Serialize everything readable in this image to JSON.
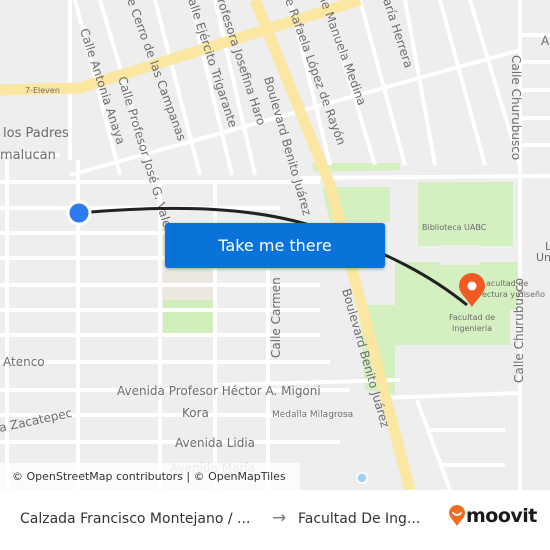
{
  "map": {
    "streets": {
      "calle_antonia_anaya": "Calle Antonia Anaya",
      "calle_cerro_campanas": "e Cerro de las Campanas",
      "calle_ejercito_trigarante": "alle Ejército Trigarante",
      "profesora_josefina_haro": "rofesora Josefina Haro",
      "calle_profesor_jose_valenzuela": "Calle Profesor José G. Valenzuela",
      "rafaela_lopez_rayon": "e Rafaela López de Rayón",
      "manuela_medina": "le Manuela Medina",
      "maria_herrera": "aría Herrera",
      "calle_churubusco_top": "Calle Churubusco",
      "calle_churubusco_bottom": "Calle Churubusco",
      "boulevard_benito_juarez_top": "Boulevard Benito Juárez",
      "boulevard_benito_juarez_bottom": "Boulevard Benito Juárez",
      "calle_carmen": "Calle Carmen",
      "los_padres": "los Padres",
      "amalucan": "malucan",
      "atenco": "Atenco",
      "avenida_hector_migoni": "Avenida Profesor Héctor A. Migoni",
      "zacatepec": "a Zacatepec",
      "kora": "Kora",
      "medalla_milagrosa": "Medalla Milagrosa",
      "avenida_lidia": "Avenida Lidia",
      "avenida_maria": "Avenida María",
      "edge_a": "A",
      "edge_l": "L",
      "edge_uni": "Uni"
    },
    "pois": {
      "seven_eleven": "7-Eleven",
      "biblioteca_uabc": "Biblioteca UABC",
      "facultad_arquitectura_line1": "acultad de",
      "facultad_arquitectura_line2": "ectura y Diseño",
      "facultad_ingenieria_line1": "Facultad de",
      "facultad_ingenieria_line2": "Ingeniería"
    },
    "origin_marker": {
      "label": "origin",
      "color": "#2d7bf0"
    },
    "destination_marker": {
      "label": "destination",
      "color": "#f15a22"
    },
    "route_color": "#222222",
    "cta_button": {
      "label": "Take me there",
      "color": "#0a73d9"
    },
    "attribution": "© OpenStreetMap contributors | © OpenMapTiles"
  },
  "footer": {
    "origin": "Calzada Francisco Montejano / ...",
    "arrow": "→",
    "destination": "Facultad De Ing...",
    "brand": "moovit",
    "brand_color": "#f26c1f"
  }
}
